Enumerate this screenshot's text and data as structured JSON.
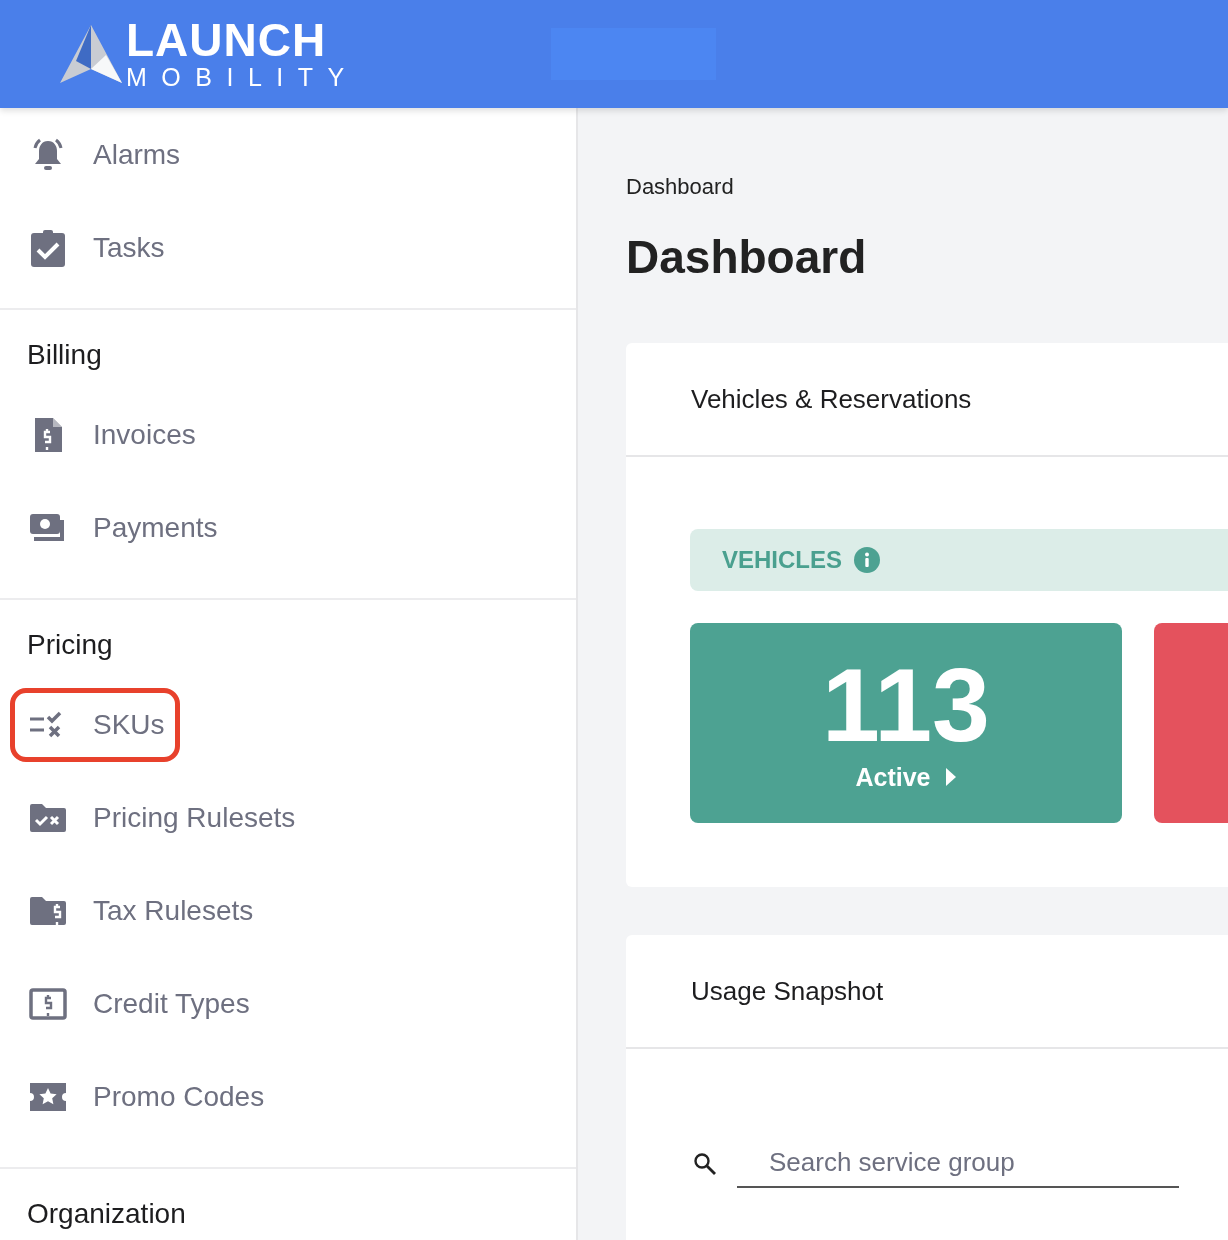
{
  "header": {
    "logo": {
      "name": "LAUNCH",
      "tagline": "MOBILITY"
    }
  },
  "sidebar": {
    "sections": [
      {
        "items": [
          {
            "label": "Alarms",
            "highlighted": false
          },
          {
            "label": "Tasks",
            "highlighted": false
          }
        ]
      },
      {
        "heading": "Billing",
        "items": [
          {
            "label": "Invoices",
            "highlighted": false
          },
          {
            "label": "Payments",
            "highlighted": false
          }
        ]
      },
      {
        "heading": "Pricing",
        "items": [
          {
            "label": "SKUs",
            "highlighted": true
          },
          {
            "label": "Pricing Rulesets",
            "highlighted": false
          },
          {
            "label": "Tax Rulesets",
            "highlighted": false
          },
          {
            "label": "Credit Types",
            "highlighted": false
          },
          {
            "label": "Promo Codes",
            "highlighted": false
          }
        ]
      },
      {
        "heading": "Organization"
      }
    ]
  },
  "breadcrumb": "Dashboard",
  "page_title": "Dashboard",
  "cards": [
    {
      "kind": "vehicles",
      "title": "Vehicles & Reservations",
      "banner": "VEHICLES",
      "tiles": [
        {
          "count": "113",
          "label": "Active",
          "color": "#4da292"
        },
        {
          "color": "#e4525d"
        }
      ]
    },
    {
      "kind": "search",
      "title": "Usage Snapshot",
      "search": {
        "placeholder": "Search service group"
      }
    }
  ]
}
